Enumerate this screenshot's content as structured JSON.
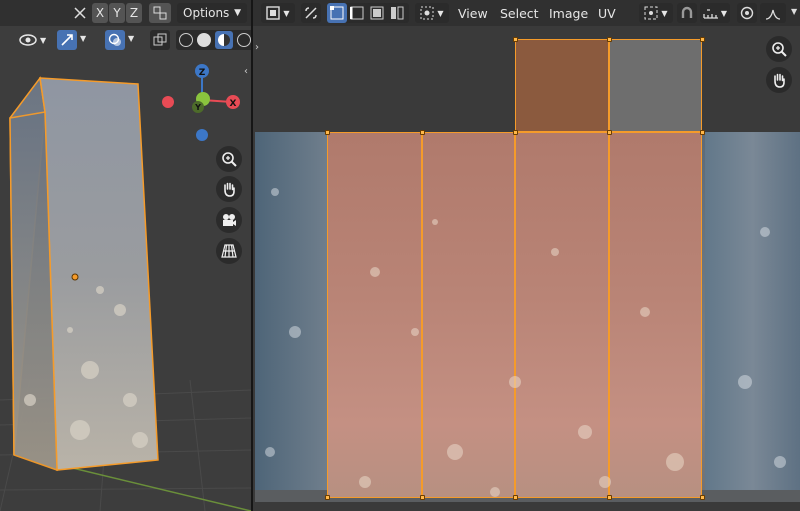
{
  "viewport3d": {
    "axes_buttons": [
      "X",
      "Y",
      "Z"
    ],
    "options_label": "Options",
    "gizmo": {
      "z": "Z",
      "x": "X",
      "y": "Y"
    },
    "icons": {
      "view_icon": "eye-icon",
      "transform_icon": "arrow-icon",
      "overlay_icon": "overlay-icon"
    }
  },
  "uv_editor": {
    "menus": [
      "View",
      "Select",
      "Image",
      "UV"
    ],
    "icons": [
      "uv-sync-icon",
      "vertex-select-icon",
      "edge-select-icon",
      "face-select-icon",
      "island-select-icon"
    ]
  },
  "colors": {
    "accent_blue": "#4772b3",
    "selection_orange": "#f59b2a",
    "header_bg": "#303030",
    "viewport_bg": "#3d3d3d",
    "axis_x": "#e84b55",
    "axis_y": "#8ac43e",
    "axis_z": "#3c77c7"
  }
}
